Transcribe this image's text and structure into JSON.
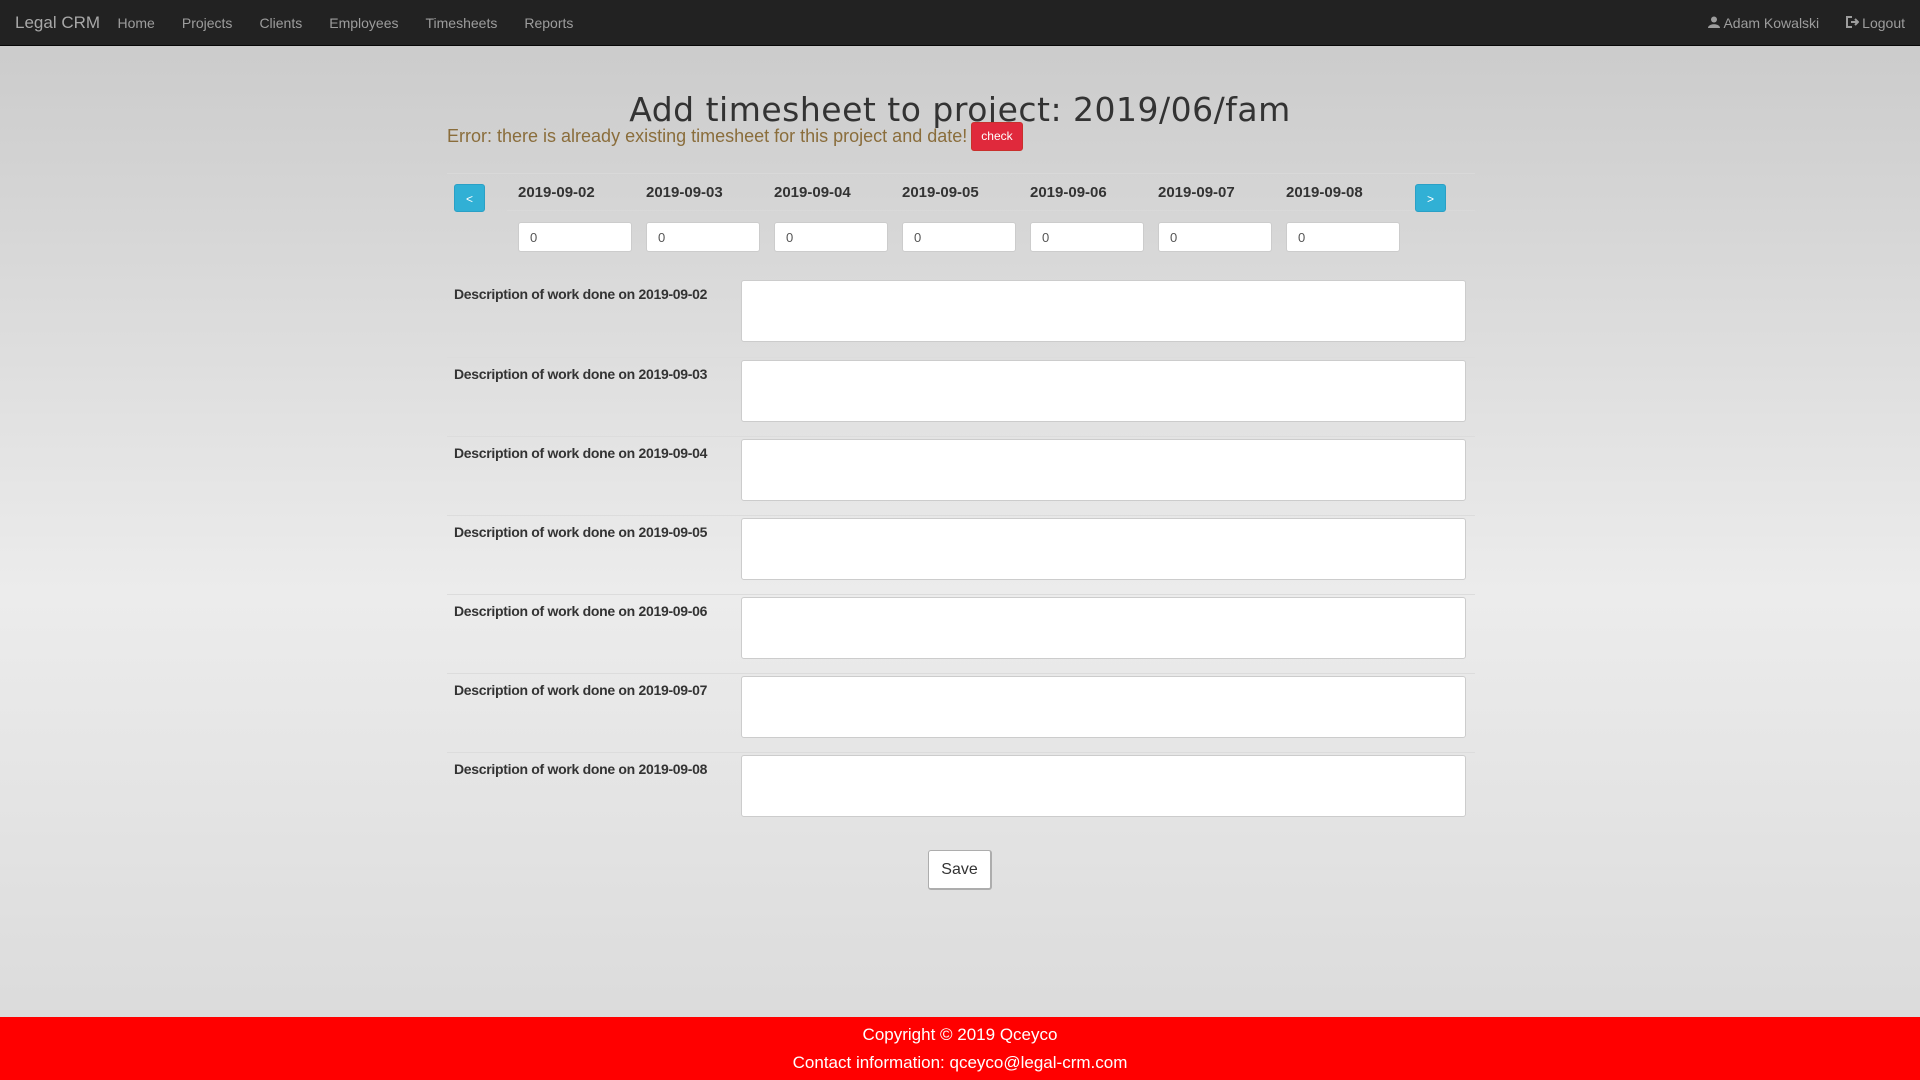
{
  "navbar": {
    "brand": "Legal CRM",
    "links": [
      "Home",
      "Projects",
      "Clients",
      "Employees",
      "Timesheets",
      "Reports"
    ],
    "user": "Adam Kowalski",
    "logout": "Logout"
  },
  "page": {
    "title": "Add timesheet to project: 2019/06/fam",
    "error_text": "Error: there is already existing timesheet for this project and date!",
    "check_label": "check"
  },
  "week": {
    "prev_label": "<",
    "next_label": ">",
    "days": [
      {
        "date": "2019-09-02",
        "hours": "0"
      },
      {
        "date": "2019-09-03",
        "hours": "0"
      },
      {
        "date": "2019-09-04",
        "hours": "0"
      },
      {
        "date": "2019-09-05",
        "hours": "0"
      },
      {
        "date": "2019-09-06",
        "hours": "0"
      },
      {
        "date": "2019-09-07",
        "hours": "0"
      },
      {
        "date": "2019-09-08",
        "hours": "0"
      }
    ]
  },
  "descriptions": [
    {
      "label": "Description of work done on 2019-09-02",
      "value": ""
    },
    {
      "label": "Description of work done on 2019-09-03",
      "value": ""
    },
    {
      "label": "Description of work done on 2019-09-04",
      "value": ""
    },
    {
      "label": "Description of work done on 2019-09-05",
      "value": ""
    },
    {
      "label": "Description of work done on 2019-09-06",
      "value": ""
    },
    {
      "label": "Description of work done on 2019-09-07",
      "value": ""
    },
    {
      "label": "Description of work done on 2019-09-08",
      "value": ""
    }
  ],
  "form": {
    "save_label": "Save"
  },
  "footer": {
    "copyright": "Copyright © 2019 Qceyco",
    "contact": "Contact information: qceyco@legal-crm.com"
  },
  "colors": {
    "navbar": "#222222",
    "error_text": "#8a6d3b",
    "check_button": "#e0293c",
    "nav_arrow_button": "#31b0d5",
    "footer": "#ff0000"
  },
  "icons": {
    "user": "user-icon",
    "logout": "logout-icon"
  }
}
